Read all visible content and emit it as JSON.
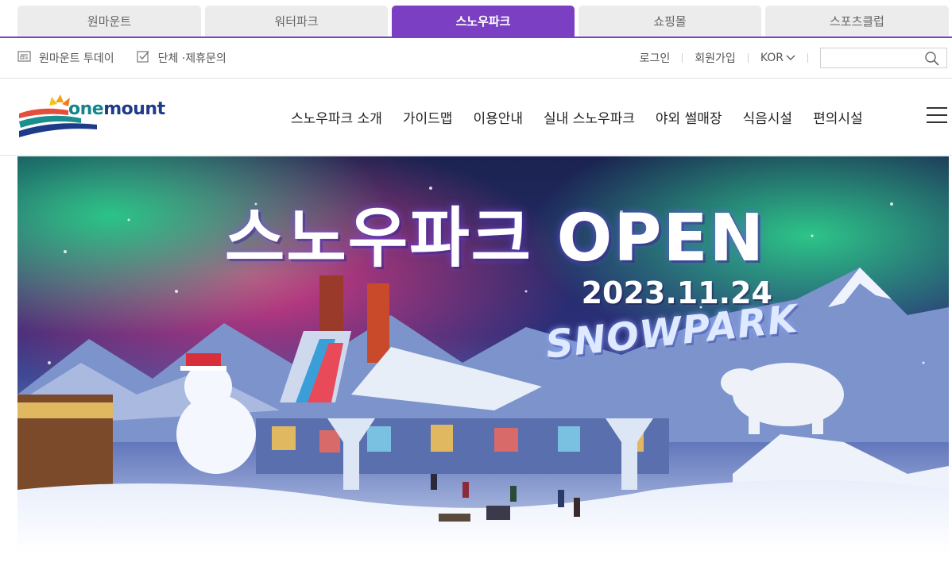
{
  "site_tabs": [
    {
      "label": "원마운트",
      "active": false
    },
    {
      "label": "워터파크",
      "active": false
    },
    {
      "label": "스노우파크",
      "active": true
    },
    {
      "label": "쇼핑몰",
      "active": false
    },
    {
      "label": "스포츠클럽",
      "active": false
    }
  ],
  "util": {
    "today_label": "원마운트 투데이",
    "group_label": "단체 ·제휴문의",
    "login": "로그인",
    "signup": "회원가입",
    "lang": "KOR",
    "search_placeholder": ""
  },
  "logo": {
    "one": "one",
    "mount": "mount"
  },
  "gnb": [
    "스노우파크 소개",
    "가이드맵",
    "이용안내",
    "실내 스노우파크",
    "야외 썰매장",
    "식음시설",
    "편의시설"
  ],
  "hero": {
    "title": "스노우파크 OPEN",
    "date": "2023.11.24",
    "subtitle": "SNOWPARK"
  },
  "colors": {
    "accent": "#7a3fc2",
    "tab_bg": "#ececec"
  }
}
